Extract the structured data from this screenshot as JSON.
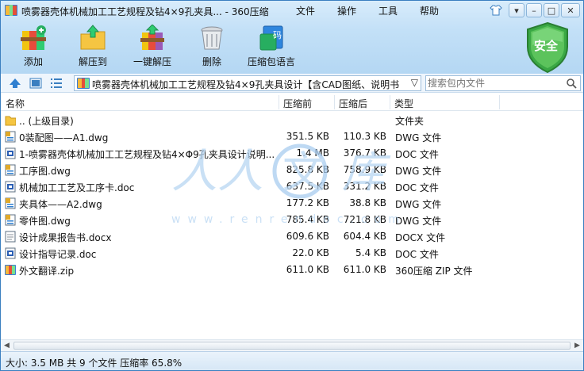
{
  "window": {
    "title": "喷雾器壳体机械加工工艺规程及钻4×9孔夹具... - 360压缩",
    "menu": [
      "文件",
      "操作",
      "工具",
      "帮助"
    ]
  },
  "toolbar": {
    "items": [
      {
        "label": "添加",
        "icon": "add-archive-icon"
      },
      {
        "label": "解压到",
        "icon": "extract-to-icon"
      },
      {
        "label": "一键解压",
        "icon": "one-click-extract-icon"
      },
      {
        "label": "删除",
        "icon": "trash-icon"
      },
      {
        "label": "压缩包语言",
        "icon": "archive-language-icon"
      }
    ],
    "security_badge": "安全"
  },
  "addressbar": {
    "path": "喷雾器壳体机械加工工艺规程及钻4×9孔夹具设计【含CAD图纸、说明书",
    "search_placeholder": "搜索包内文件"
  },
  "columns": [
    "名称",
    "压缩前",
    "压缩后",
    "类型"
  ],
  "files": [
    {
      "name": ".. (上级目录)",
      "before": "",
      "after": "",
      "type": "文件夹",
      "icon": "folder-icon"
    },
    {
      "name": "0装配图——A1.dwg",
      "before": "351.5 KB",
      "after": "110.3 KB",
      "type": "DWG 文件",
      "icon": "dwg-file-icon"
    },
    {
      "name": "1-喷雾器壳体机械加工工艺规程及钻4×Φ9孔夹具设计说明...",
      "before": "1.4 MB",
      "after": "376.7 KB",
      "type": "DOC 文件",
      "icon": "doc-file-icon"
    },
    {
      "name": "工序图.dwg",
      "before": "825.8 KB",
      "after": "758.9 KB",
      "type": "DWG 文件",
      "icon": "dwg-file-icon"
    },
    {
      "name": "机械加工工艺及工序卡.doc",
      "before": "637.5 KB",
      "after": "331.2 KB",
      "type": "DOC 文件",
      "icon": "doc-file-icon"
    },
    {
      "name": "夹具体——A2.dwg",
      "before": "177.2 KB",
      "after": "38.8 KB",
      "type": "DWG 文件",
      "icon": "dwg-file-icon"
    },
    {
      "name": "零件图.dwg",
      "before": "785.4 KB",
      "after": "721.8 KB",
      "type": "DWG 文件",
      "icon": "dwg-file-icon"
    },
    {
      "name": "设计成果报告书.docx",
      "before": "609.6 KB",
      "after": "604.4 KB",
      "type": "DOCX 文件",
      "icon": "docx-file-icon"
    },
    {
      "name": "设计指导记录.doc",
      "before": "22.0 KB",
      "after": "5.4 KB",
      "type": "DOC 文件",
      "icon": "doc-file-icon"
    },
    {
      "name": "外文翻译.zip",
      "before": "611.0 KB",
      "after": "611.0 KB",
      "type": "360压缩 ZIP 文件",
      "icon": "zip-file-icon"
    }
  ],
  "status": "大小: 3.5 MB 共 9 个文件 压缩率 65.8%"
}
